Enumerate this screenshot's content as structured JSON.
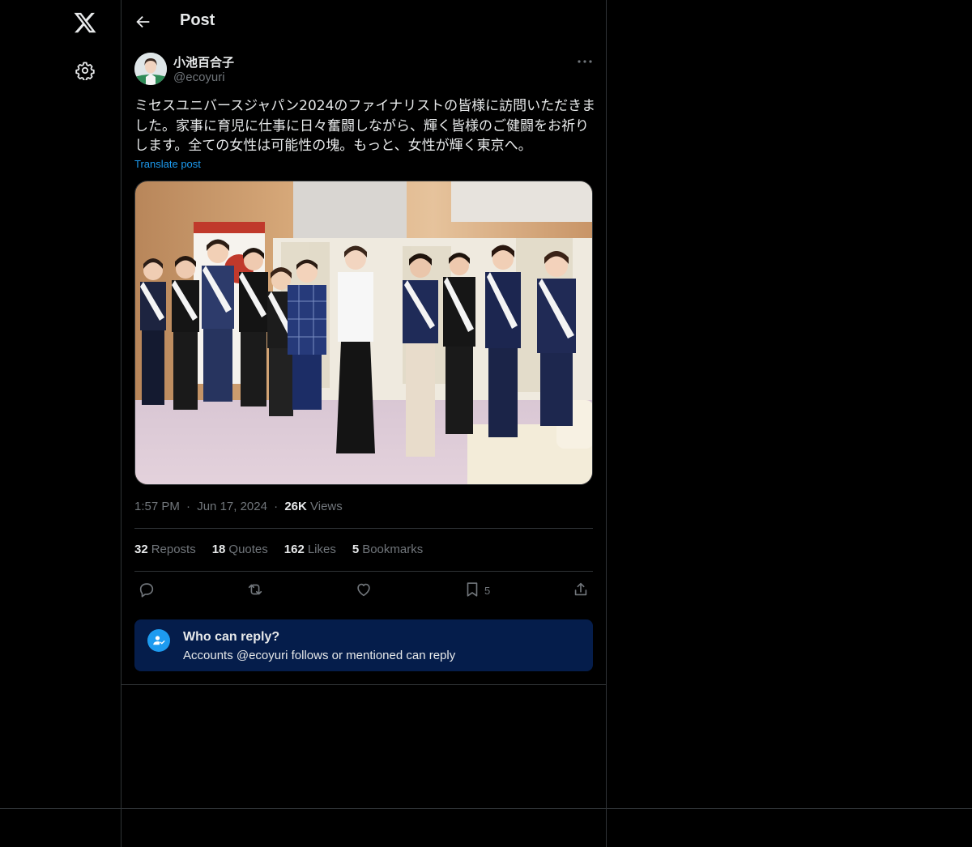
{
  "header": {
    "title": "Post"
  },
  "author": {
    "name": "小池百合子",
    "handle": "@ecoyuri"
  },
  "post": {
    "text": "ミセスユニバースジャパン2024のファイナリストの皆様に訪問いただきました。家事に育児に仕事に日々奮闘しながら、輝く皆様のご健闘をお祈りします。全ての女性は可能性の塊。もっと、女性が輝く東京へ。",
    "translate_label": "Translate post",
    "time": "1:57 PM",
    "date": "Jun 17, 2024",
    "separator": "·",
    "views_count": "26K",
    "views_label": "Views"
  },
  "stats": {
    "reposts_count": "32",
    "reposts_label": "Reposts",
    "quotes_count": "18",
    "quotes_label": "Quotes",
    "likes_count": "162",
    "likes_label": "Likes",
    "bookmarks_count": "5",
    "bookmarks_label": "Bookmarks"
  },
  "actions": {
    "bookmark_count": "5"
  },
  "reply_restriction": {
    "title": "Who can reply?",
    "subtitle": "Accounts @ecoyuri follows or mentioned can reply"
  },
  "icons": {
    "logo": "x-logo-icon",
    "settings": "gear-icon",
    "back": "arrow-left-icon",
    "more": "more-horizontal-icon",
    "reply": "reply-icon",
    "repost": "repost-icon",
    "like": "heart-icon",
    "bookmark": "bookmark-icon",
    "share": "share-icon",
    "reply_restriction": "person-check-icon"
  },
  "colors": {
    "background": "#000000",
    "accent": "#1d9bf0",
    "muted": "#71767b",
    "border": "#2f3336",
    "reply_box": "#051d4b"
  }
}
